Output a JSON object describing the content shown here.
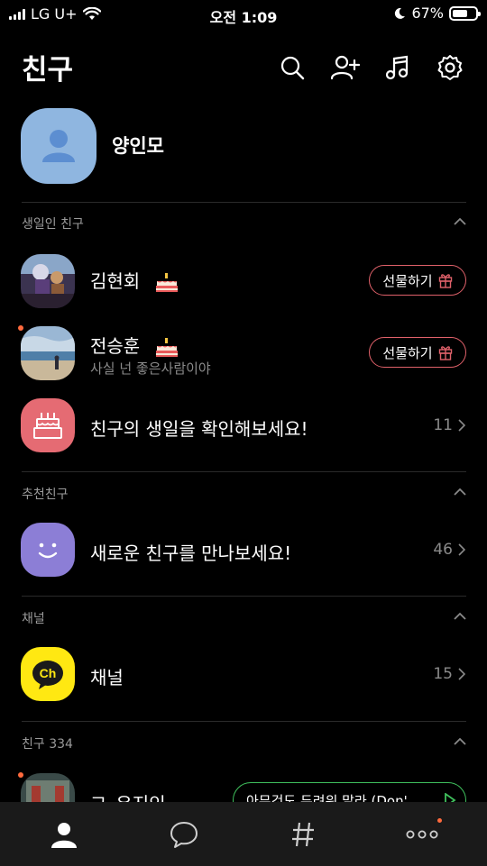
{
  "status_bar": {
    "carrier": "LG U+",
    "time": "오전 1:09",
    "battery_percent": "67%",
    "battery_level": 0.67
  },
  "header": {
    "title": "친구",
    "icons": [
      "search-icon",
      "add-friend-icon",
      "music-icon",
      "settings-icon"
    ]
  },
  "profile": {
    "name": "양인모"
  },
  "sections": {
    "birthday": {
      "title": "생일인 친구",
      "friends": [
        {
          "name": "김현회",
          "status": "",
          "gift_label": "선물하기"
        },
        {
          "name": "전승훈",
          "status": "사실 넌 좋은사람이야",
          "gift_label": "선물하기"
        }
      ],
      "check_label": "친구의 생일을 확인해보세요!",
      "check_count": "11"
    },
    "recommended": {
      "title": "추천친구",
      "label": "새로운 친구를 만나보세요!",
      "count": "46"
    },
    "channel": {
      "title": "채널",
      "label": "채널",
      "count": "15",
      "logo_text": "Ch"
    },
    "friends": {
      "title": "친구 334",
      "first_name": "그_유지인",
      "music_text": "아무것도 두려워 말라 (Don'"
    }
  },
  "tabbar": {
    "tabs": [
      "friends-tab",
      "chats-tab",
      "openchat-tab",
      "more-tab"
    ]
  },
  "colors": {
    "background": "#000000",
    "gift_border": "#e0616a",
    "channel_yellow": "#ffe812",
    "recommend_purple": "#8c7ed6",
    "birthday_pink": "#e56b73",
    "music_green": "#3fbf5c",
    "profile_blue": "#8fb6e0"
  }
}
